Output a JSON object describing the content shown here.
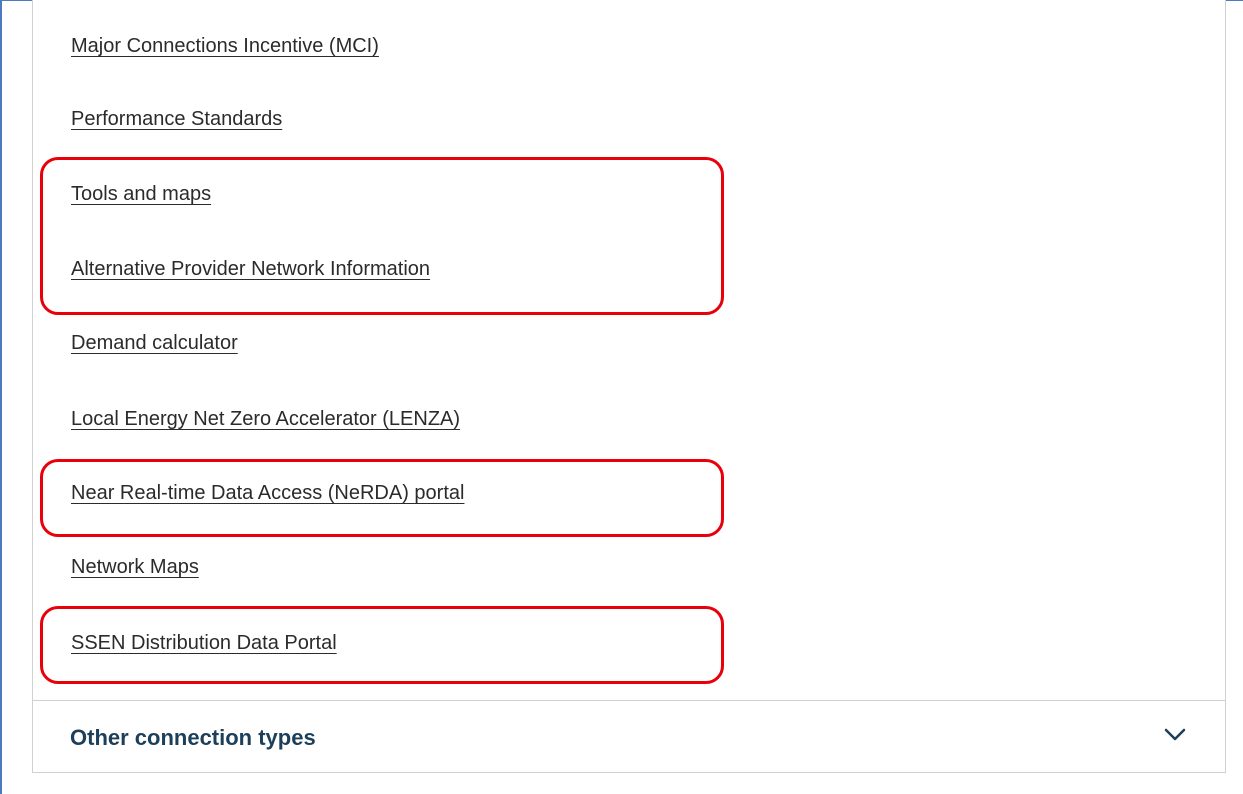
{
  "links": [
    {
      "id": "mci",
      "label": "Major Connections Incentive (MCI)"
    },
    {
      "id": "performance",
      "label": "Performance Standards"
    },
    {
      "id": "tools",
      "label": "Tools and maps"
    },
    {
      "id": "alt-provider",
      "label": "Alternative Provider Network Information"
    },
    {
      "id": "demand",
      "label": "Demand calculator"
    },
    {
      "id": "lenza",
      "label": "Local Energy Net Zero Accelerator (LENZA)"
    },
    {
      "id": "nerda",
      "label": "Near Real-time Data Access (NeRDA) portal"
    },
    {
      "id": "network-maps",
      "label": "Network Maps"
    },
    {
      "id": "ssen",
      "label": "SSEN Distribution Data Portal"
    }
  ],
  "accordion": {
    "label": "Other connection types",
    "icon": "chevron-down-icon",
    "expanded": false
  },
  "colors": {
    "highlight": "#e8000b",
    "heading": "#1d3f5a",
    "link": "#2b2b2b",
    "frame": "#4a7bbf"
  }
}
